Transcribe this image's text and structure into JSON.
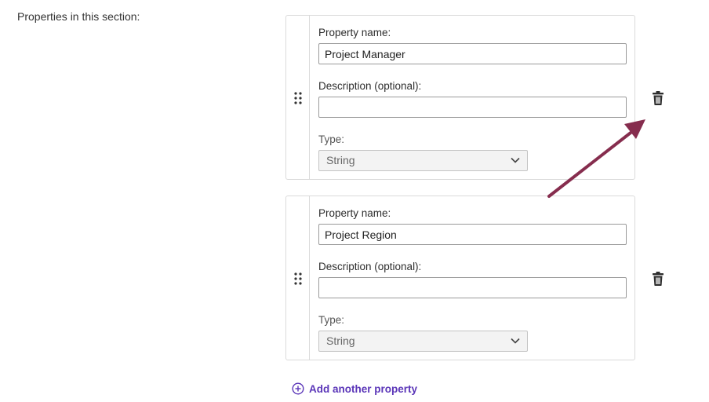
{
  "section": {
    "label": "Properties in this section:"
  },
  "properties": [
    {
      "name_label": "Property name:",
      "name_value": "Project Manager",
      "description_label": "Description (optional):",
      "description_value": "",
      "type_label": "Type:",
      "type_value": "String"
    },
    {
      "name_label": "Property name:",
      "name_value": "Project Region",
      "description_label": "Description (optional):",
      "description_value": "",
      "type_label": "Type:",
      "type_value": "String"
    }
  ],
  "actions": {
    "add_property_label": "Add another property"
  },
  "icons": {
    "drag": "drag-handle-icon",
    "delete": "trash-icon",
    "chevron": "chevron-down-icon",
    "add": "plus-circle-icon"
  },
  "colors": {
    "accent": "#5a35b8",
    "annotation_arrow": "#862d4e",
    "border": "#dadada"
  }
}
